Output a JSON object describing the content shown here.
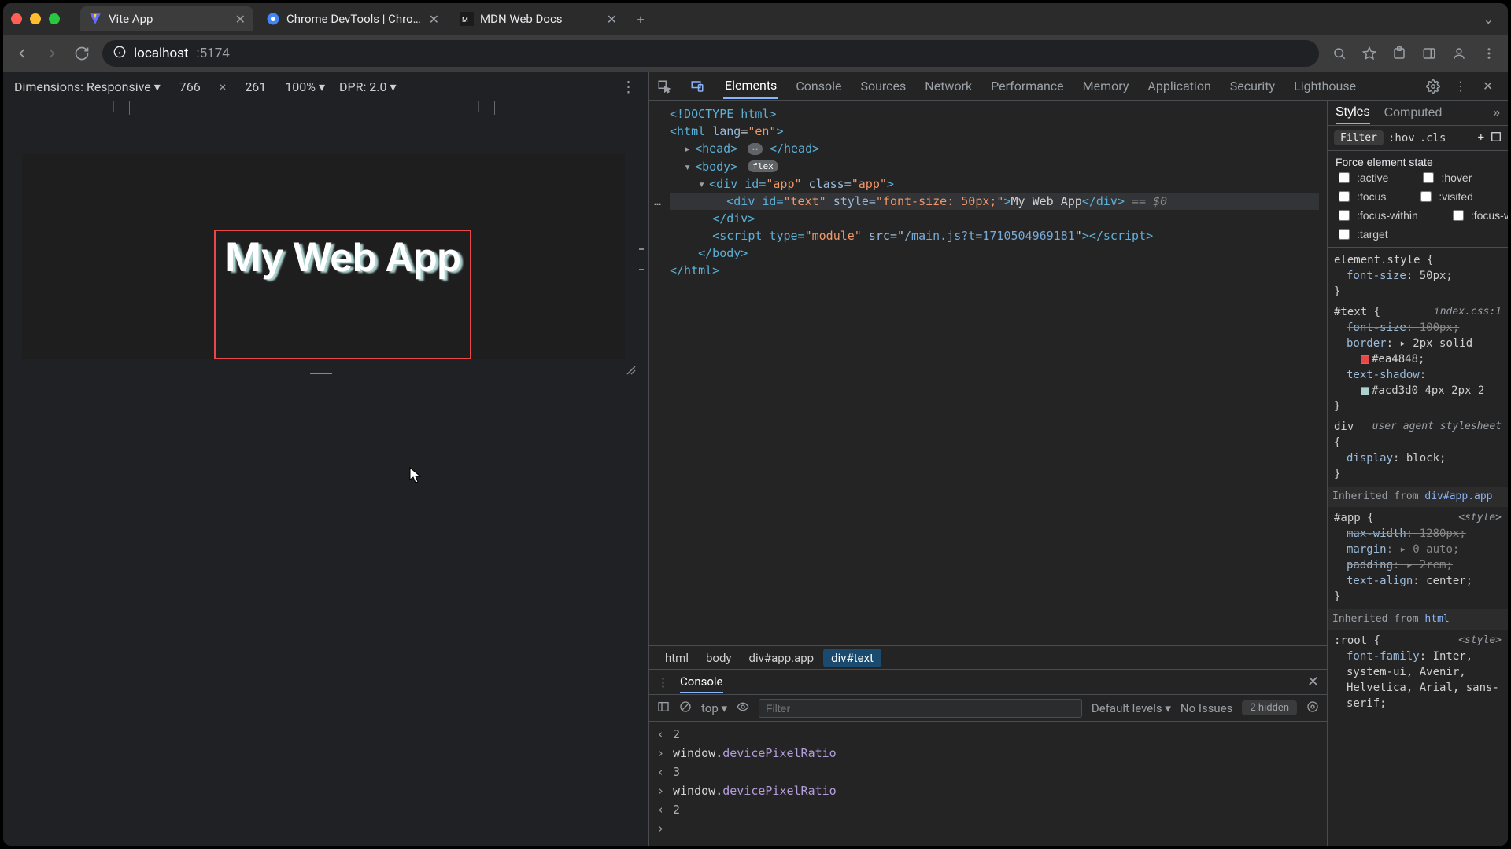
{
  "tabs": [
    {
      "title": "Vite App"
    },
    {
      "title": "Chrome DevTools | Chrome"
    },
    {
      "title": "MDN Web Docs"
    }
  ],
  "address": {
    "host": "localhost",
    "port": ":5174"
  },
  "device_toolbar": {
    "label": "Dimensions: Responsive",
    "width": "766",
    "height": "261",
    "zoom": "100%",
    "dpr": "DPR: 2.0"
  },
  "page": {
    "text": "My Web App"
  },
  "devtools_tabs": [
    "Elements",
    "Console",
    "Sources",
    "Network",
    "Performance",
    "Memory",
    "Application",
    "Security",
    "Lighthouse"
  ],
  "devtools_active_tab_index": 0,
  "dom": {
    "doctype": "<!DOCTYPE html>",
    "html_open": "<html lang=\"en\">",
    "head_open": "<head>",
    "head_close": "</head>",
    "body_open": "<body>",
    "body_badge": "flex",
    "app_open_pre": "<div id=",
    "app_id": "\"app\"",
    "app_class_attr": " class=",
    "app_class_val": "\"app\"",
    "gt": ">",
    "text_div_pre": "<div id=",
    "text_id": "\"text\"",
    "style_attr": " style=",
    "style_val": "\"font-size: 50px;\"",
    "text_content": "My Web App",
    "div_close": "</div>",
    "eq0": " == $0",
    "script_open": "<script type=",
    "script_type": "\"module\"",
    "script_src_attr": " src=",
    "script_src_val": "/main.js?t=1710504969181",
    "script_close": "></script>",
    "body_close": "</body>",
    "html_close": "</html>"
  },
  "breadcrumbs": [
    "html",
    "body",
    "div#app.app",
    "div#text"
  ],
  "breadcrumb_selected_index": 3,
  "styles_tabs": [
    "Styles",
    "Computed"
  ],
  "styles_toolbar": {
    "filter_label": "Filter",
    "hov": ":hov",
    "cls": ".cls"
  },
  "force_state_title": "Force element state",
  "pseudos": [
    ":active",
    ":hover",
    ":focus",
    ":visited",
    ":focus-within",
    ":focus-v",
    ":target"
  ],
  "css": {
    "elem_style_open": "element.style {",
    "elem_style_prop": "font-size",
    "elem_style_val": "50px;",
    "close_brace": "}",
    "text_sel": "#text {",
    "text_src": "index.css:1",
    "text_p1_name": "font-size",
    "text_p1_val": "100px;",
    "text_p2_name": "border",
    "text_p2_val": "2px solid",
    "text_p2_color": "#ea4848",
    "text_p3_name": "text-shadow",
    "text_p3_color": "#acd3d0",
    "text_p3_rest": "4px 2px 2",
    "div_sel": "div",
    "ua_label": "user agent stylesheet",
    "div_p1_name": "display",
    "div_p1_val": "block;",
    "inh1_label": "Inherited from ",
    "inh1_code": "div#app.app",
    "app_sel": "#app {",
    "app_src": "<style>",
    "app_p1_name": "max-width",
    "app_p1_val": "1280px;",
    "app_p2_name": "margin",
    "app_p2_val": "0 auto;",
    "app_p3_name": "padding",
    "app_p3_val": "2rem;",
    "app_p4_name": "text-align",
    "app_p4_val": "center;",
    "inh2_label": "Inherited from ",
    "inh2_code": "html",
    "root_sel": ":root {",
    "root_src": "<style>",
    "root_p1_name": "font-family",
    "root_p1_val": "Inter, system-ui, Avenir, Helvetica, Arial, sans-serif;"
  },
  "console": {
    "tab": "Console",
    "top": "top",
    "filter_placeholder": "Filter",
    "levels": "Default levels",
    "no_issues": "No Issues",
    "hidden": "2 hidden",
    "rows": [
      {
        "dir": "out",
        "text": "2"
      },
      {
        "dir": "in",
        "obj": "window",
        "prop": "devicePixelRatio"
      },
      {
        "dir": "out",
        "text": "3"
      },
      {
        "dir": "in",
        "obj": "window",
        "prop": "devicePixelRatio"
      },
      {
        "dir": "out",
        "text": "2"
      }
    ]
  }
}
